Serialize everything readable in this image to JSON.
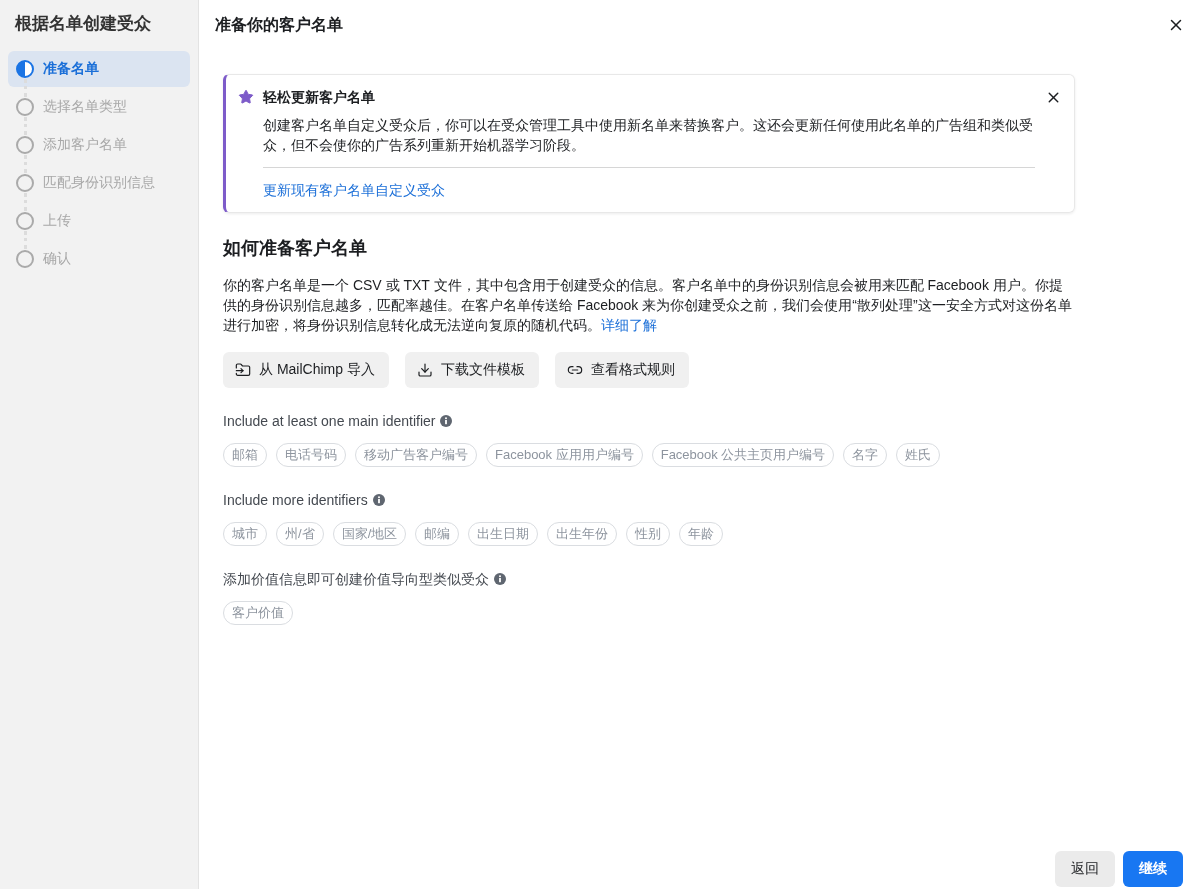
{
  "sidebar": {
    "title": "根据名单创建受众",
    "steps": [
      {
        "label": "准备名单",
        "selected": true
      },
      {
        "label": "选择名单类型",
        "selected": false
      },
      {
        "label": "添加客户名单",
        "selected": false
      },
      {
        "label": "匹配身份识别信息",
        "selected": false
      },
      {
        "label": "上传",
        "selected": false
      },
      {
        "label": "确认",
        "selected": false
      }
    ]
  },
  "header": {
    "title": "准备你的客户名单"
  },
  "notice": {
    "title": "轻松更新客户名单",
    "body": "创建客户名单自定义受众后，你可以在受众管理工具中使用新名单来替换客户。这还会更新任何使用此名单的广告组和类似受众，但不会使你的广告系列重新开始机器学习阶段。",
    "link": "更新现有客户名单自定义受众"
  },
  "guide": {
    "heading": "如何准备客户名单",
    "text": "你的客户名单是一个 CSV 或 TXT 文件，其中包含用于创建受众的信息。客户名单中的身份识别信息会被用来匹配 Facebook 用户。你提供的身份识别信息越多，匹配率越佳。在客户名单传送给 Facebook 来为你创建受众之前，我们会使用“散列处理”这一安全方式对这份名单进行加密，将身份识别信息转化成无法逆向复原的随机代码。",
    "link": "详细了解",
    "actions": [
      {
        "kind": "import",
        "label": "从 MailChimp 导入"
      },
      {
        "kind": "download",
        "label": "下载文件模板"
      },
      {
        "kind": "link",
        "label": "查看格式规则"
      }
    ]
  },
  "identifier_groups": [
    {
      "label": "Include at least one main identifier",
      "tags": [
        "邮箱",
        "电话号码",
        "移动广告客户编号",
        "Facebook 应用用户编号",
        "Facebook 公共主页用户编号",
        "名字",
        "姓氏"
      ]
    },
    {
      "label": "Include more identifiers",
      "tags": [
        "城市",
        "州/省",
        "国家/地区",
        "邮编",
        "出生日期",
        "出生年份",
        "性别",
        "年龄"
      ]
    },
    {
      "label": "添加价值信息即可创建价值导向型类似受众",
      "tags": [
        "客户价值"
      ]
    }
  ],
  "footer": {
    "buttons": [
      {
        "kind": "secondary",
        "label": "返回"
      },
      {
        "kind": "primary",
        "label": "继续"
      }
    ]
  }
}
